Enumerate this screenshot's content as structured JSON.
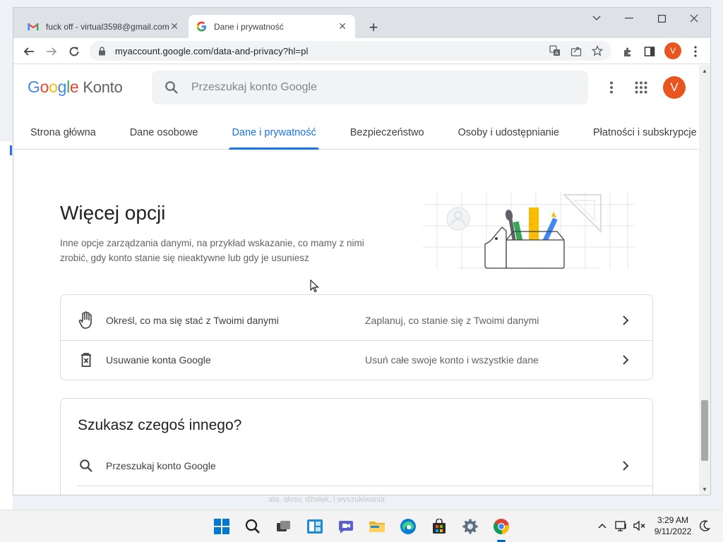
{
  "browser": {
    "tabs": [
      {
        "title": "fuck off - virtual3598@gmail.com",
        "favicon": "gmail-icon"
      },
      {
        "title": "Dane i prywatność",
        "favicon": "google-g-icon"
      }
    ],
    "address": "myaccount.google.com/data-and-privacy?hl=pl",
    "profile_initial": "V"
  },
  "header": {
    "logo_google": [
      "G",
      "o",
      "o",
      "g",
      "l",
      "e"
    ],
    "logo_product": "Konto",
    "search_placeholder": "Przeszukaj konto Google",
    "avatar_initial": "V"
  },
  "nav": {
    "tabs": [
      {
        "label": "Strona główna"
      },
      {
        "label": "Dane osobowe"
      },
      {
        "label": "Dane i prywatność",
        "active": true
      },
      {
        "label": "Bezpieczeństwo"
      },
      {
        "label": "Osoby i udostępnianie"
      },
      {
        "label": "Płatności i subskrypcje"
      }
    ]
  },
  "section_more": {
    "title": "Więcej opcji",
    "description": "Inne opcje zarządzania danymi, na przykład wskazanie, co mamy z nimi zrobić, gdy konto stanie się nieaktywne lub gdy je usuniesz",
    "rows": [
      {
        "label": "Określ, co ma się stać z Twoimi danymi",
        "description": "Zaplanuj, co stanie się z Twoimi danymi",
        "icon": "hand-icon"
      },
      {
        "label": "Usuwanie konta Google",
        "description": "Usuń całe swoje konto i wszystkie dane",
        "icon": "delete-box-icon"
      }
    ]
  },
  "section_else": {
    "title": "Szukasz czegoś innego?",
    "rows": [
      {
        "label": "Przeszukaj konto Google",
        "icon": "search-icon"
      }
    ]
  },
  "behind_window_text": "ata, głosy, dźwięk, i wyszukiwania",
  "taskbar": {
    "time": "3:29 AM",
    "date": "9/11/2022"
  },
  "colors": {
    "accent": "#1a73e8",
    "avatar": "#e8551f"
  }
}
